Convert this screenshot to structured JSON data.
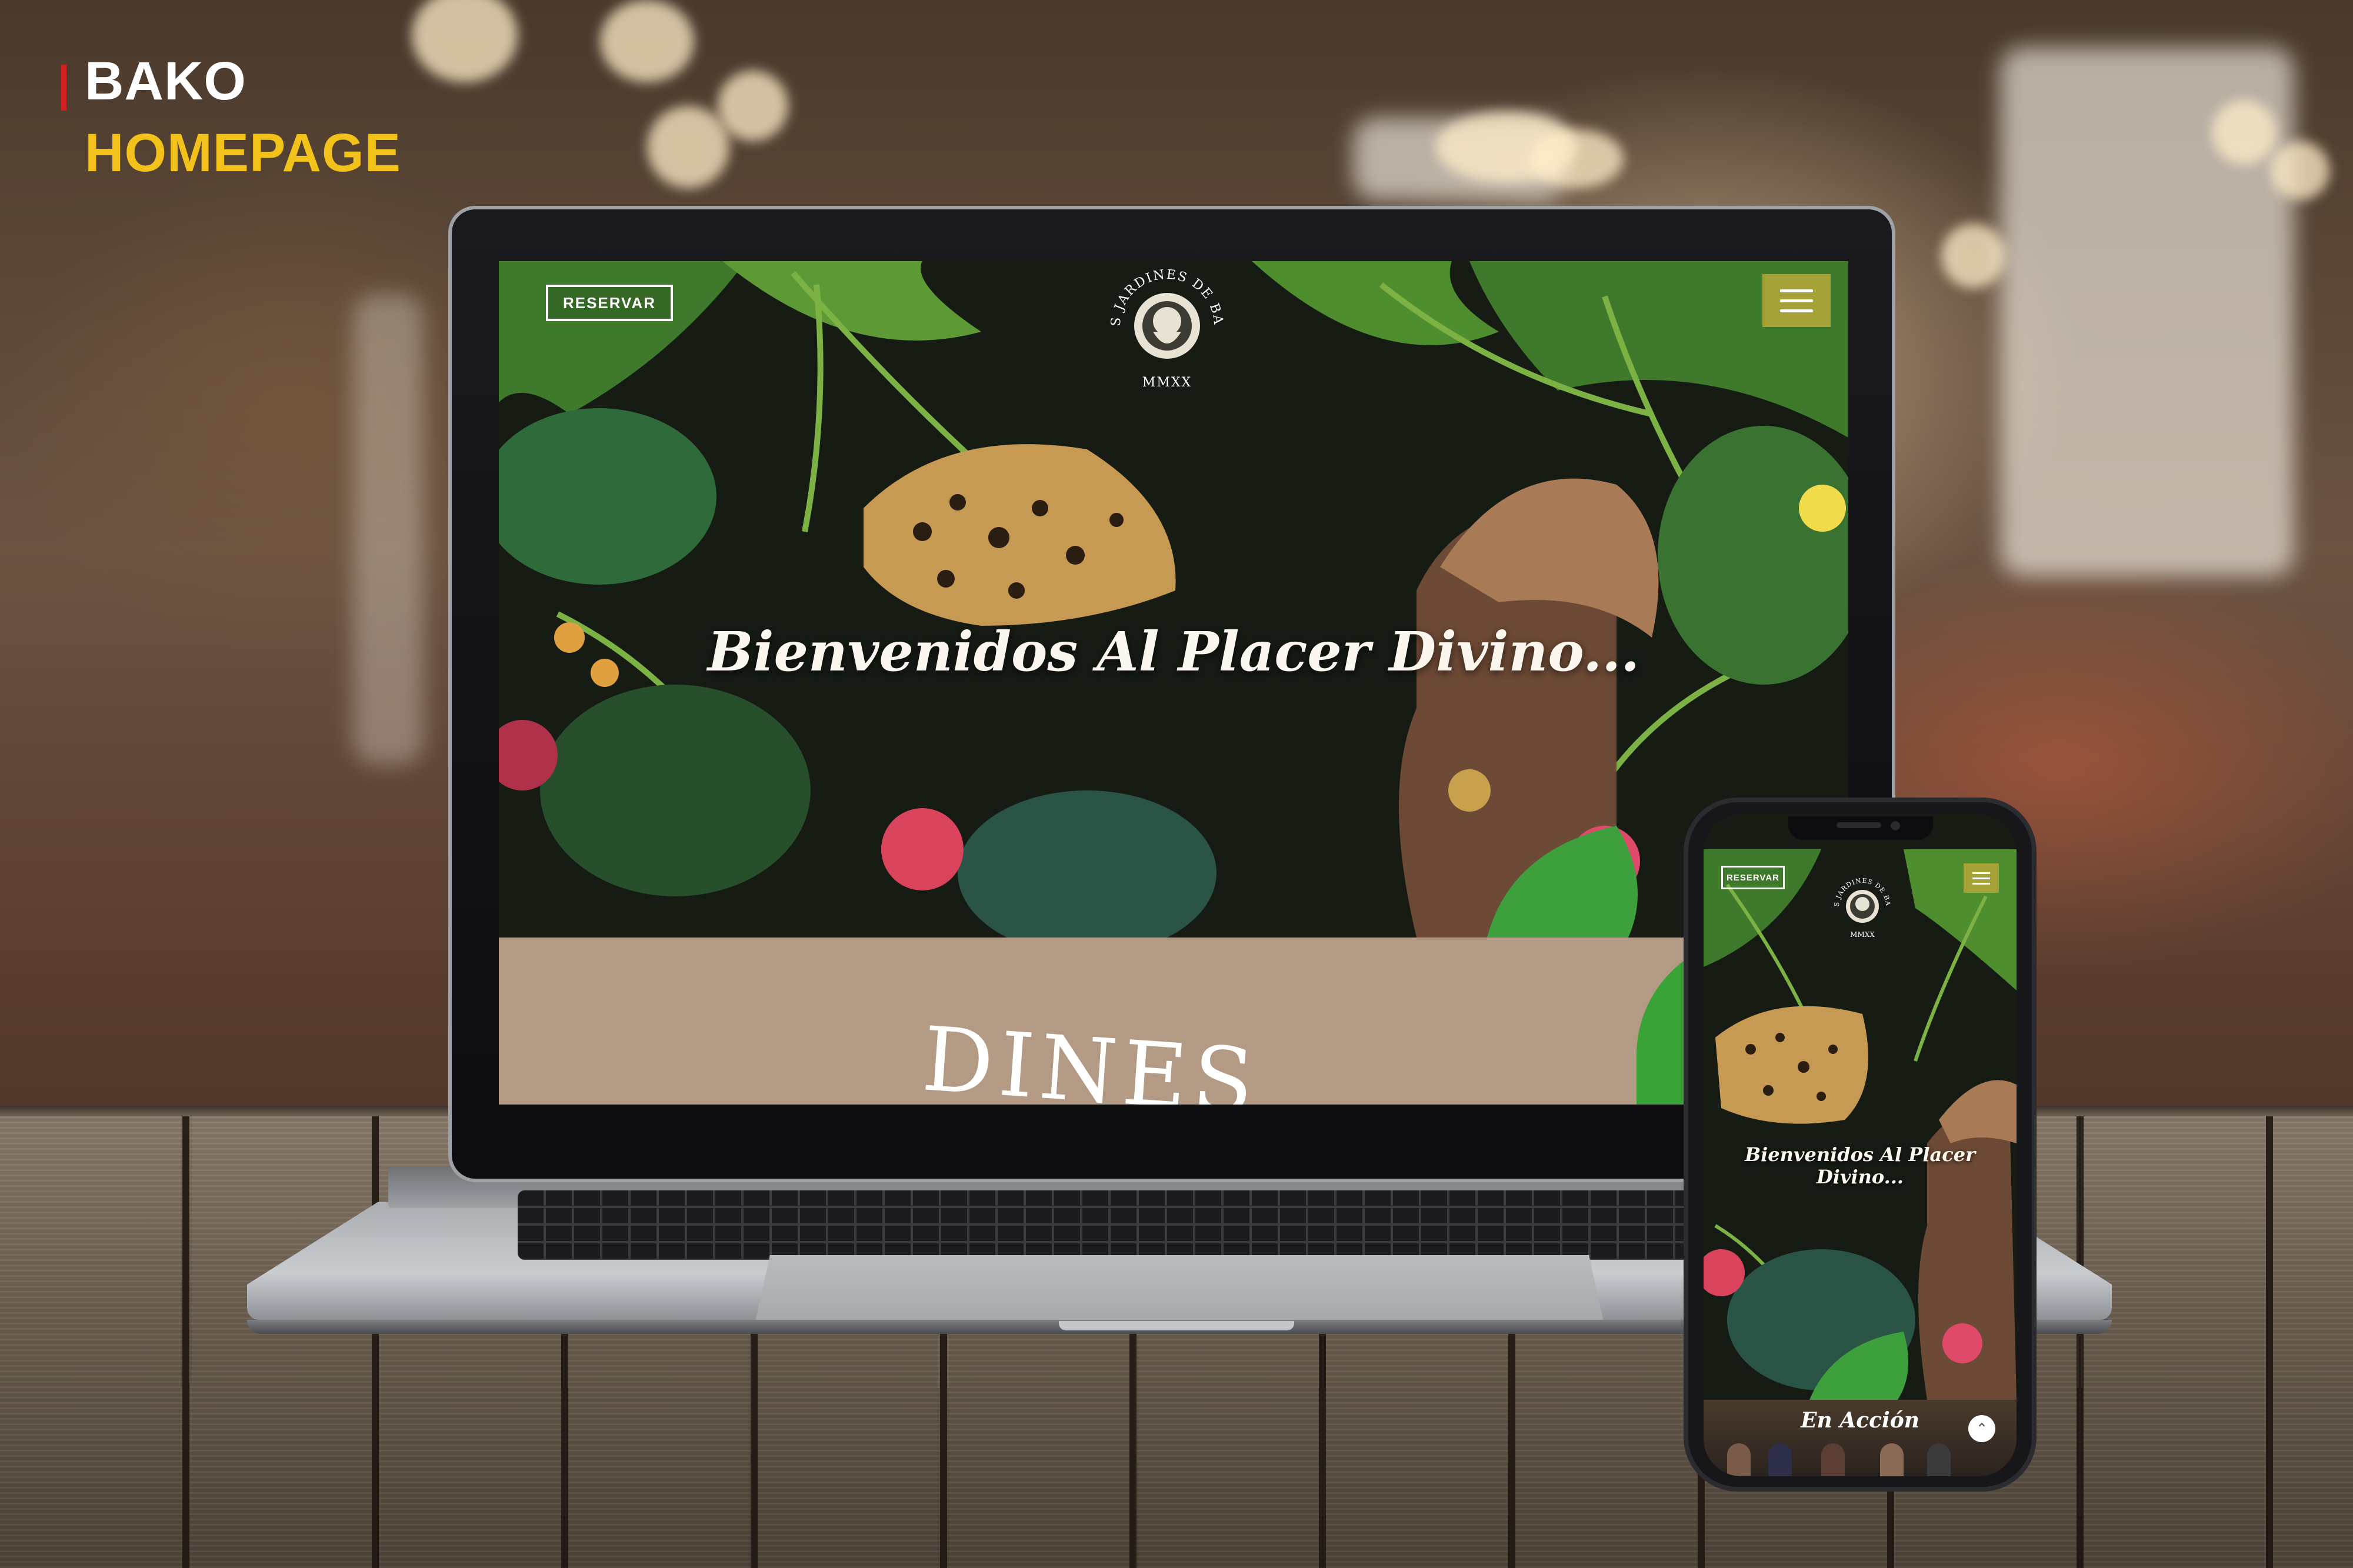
{
  "presentation": {
    "title": "BAKO",
    "subtitle": "HOMEPAGE",
    "accent_color": "#d21f1f",
    "subtitle_color": "#f3c21a"
  },
  "desktop": {
    "reserve_button": "RESERVAR",
    "menu_icon": "hamburger-menu-icon",
    "logo": {
      "text": "LOS JARDINES DE BAKO",
      "year": "MMXX"
    },
    "headline": "Bienvenidos Al Placer Divino...",
    "section_text": "DINES",
    "menu_color": "#a5a338"
  },
  "mobile": {
    "reserve_button": "RESERVAR",
    "menu_icon": "hamburger-menu-icon",
    "logo": {
      "text": "LOS JARDINES DE BAKO",
      "year": "MMXX"
    },
    "headline": "Bienvenidos Al Placer Divino...",
    "footer_title": "En Acción",
    "scroll_top_icon": "chevron-up-icon"
  }
}
